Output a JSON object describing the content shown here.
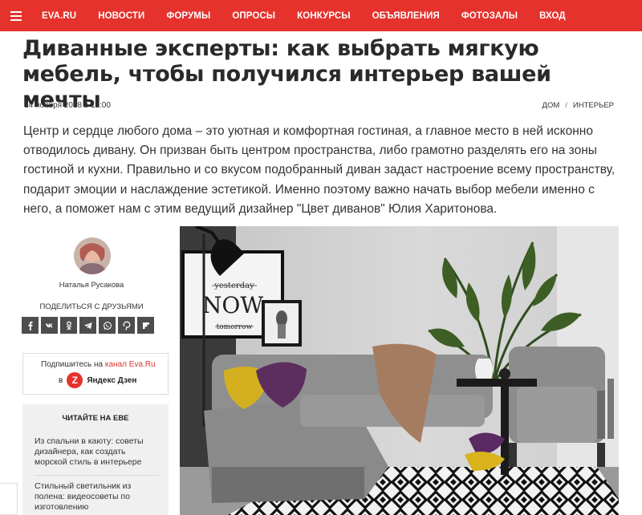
{
  "nav": {
    "items": [
      "EVA.RU",
      "НОВОСТИ",
      "ФОРУМЫ",
      "ОПРОСЫ",
      "КОНКУРСЫ",
      "ОБЪЯВЛЕНИЯ",
      "ФОТОЗАЛЫ",
      "ВХОД"
    ]
  },
  "article": {
    "title": "Диванные эксперты: как выбрать мягкую мебель, чтобы получился интерьер вашей мечты",
    "date": "14 ноября 2018 в 12:00",
    "breadcrumbs": [
      "ДОМ",
      "ИНТЕРЬЕР"
    ],
    "breadcrumb_separator": "/",
    "lead": "Центр и сердце любого дома – это уютная и комфортная гостиная, а главное место в ней исконно отводилось дивану. Он призван быть центром пространства, либо грамотно разделять его на зоны гостиной и кухни. Правильно и со вкусом подобранный диван задаст настроение всему пространству, подарит эмоции и наслаждение эстетикой. Именно поэтому важно начать выбор мебели именно с него, а поможет нам с этим ведущий дизайнер \"Цвет диванов\" Юлия Харитонова."
  },
  "author": {
    "name": "Наталья Русакова"
  },
  "share": {
    "title": "ПОДЕЛИТЬСЯ С ДРУЗЬЯМИ",
    "buttons": [
      "facebook-icon",
      "vk-icon",
      "odnoklassniki-icon",
      "telegram-icon",
      "whatsapp-icon",
      "pinterest-icon",
      "flipboard-icon"
    ]
  },
  "subscribe": {
    "prefix": "Подпишитесь на ",
    "link": "канал Eva.Ru",
    "in_label": "в",
    "service": "Яндекс Дзен"
  },
  "read_more": {
    "title": "ЧИТАЙТЕ НА ЕВЕ",
    "items": [
      "Из спальни в каюту: советы дизайнера, как создать морской стиль в интерьере",
      "Стильный светильник из полена: видеосоветы по изготовлению"
    ]
  },
  "photo": {
    "poster_top": "yesterday",
    "poster_main": "NOW.",
    "poster_bottom": "tomorrow"
  },
  "colors": {
    "brand_red": "#e5322d",
    "share_gray": "#4d4d4d"
  }
}
